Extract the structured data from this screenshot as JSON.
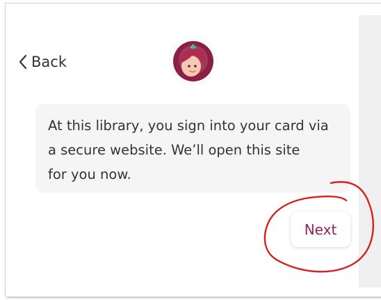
{
  "nav": {
    "back_label": "Back"
  },
  "logo": {
    "icon": "libby-logo-icon"
  },
  "message": {
    "lines": [
      "At this library, you sign into your card via",
      "a secure website. We’ll open this site",
      "for you now."
    ]
  },
  "actions": {
    "next_label": "Next"
  },
  "colors": {
    "accent": "#8a2456",
    "annotation": "#d81f1f",
    "bubble_bg": "#f5f5f6"
  }
}
